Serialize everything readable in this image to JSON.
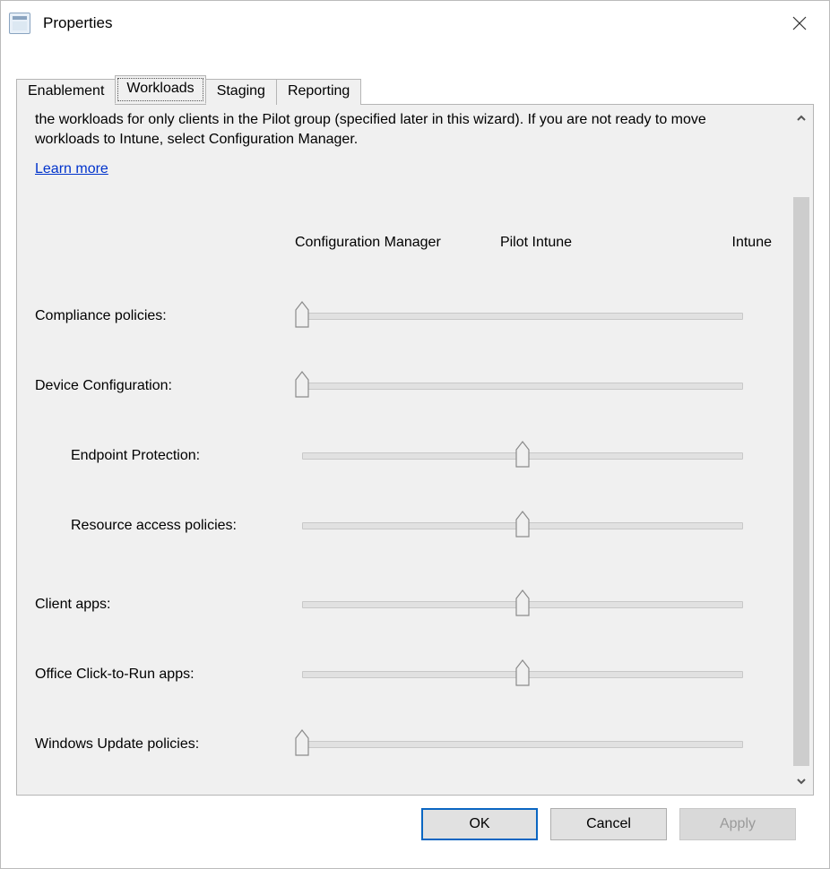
{
  "window": {
    "title": "Properties"
  },
  "tabs": [
    {
      "label": "Enablement",
      "active": false
    },
    {
      "label": "Workloads",
      "active": true
    },
    {
      "label": "Staging",
      "active": false
    },
    {
      "label": "Reporting",
      "active": false
    }
  ],
  "intro_cutoff_char": "◡",
  "intro_text": "the workloads for only clients in the Pilot group (specified later in this wizard). If you are not ready to move workloads to Intune, select Configuration Manager.",
  "learn_more": "Learn more",
  "columns": {
    "left": "Configuration Manager",
    "center": "Pilot Intune",
    "right": "Intune"
  },
  "workloads": [
    {
      "label": "Compliance policies:",
      "indent": false,
      "pos": 0
    },
    {
      "label": "Device Configuration:",
      "indent": false,
      "pos": 0
    },
    {
      "label": "Endpoint Protection:",
      "indent": true,
      "pos": 1
    },
    {
      "label": "Resource access policies:",
      "indent": true,
      "pos": 1
    },
    {
      "label": "Client apps:",
      "indent": false,
      "pos": 1
    },
    {
      "label": "Office Click-to-Run apps:",
      "indent": false,
      "pos": 1
    },
    {
      "label": "Windows Update policies:",
      "indent": false,
      "pos": 0
    }
  ],
  "buttons": {
    "ok": "OK",
    "cancel": "Cancel",
    "apply": "Apply"
  }
}
